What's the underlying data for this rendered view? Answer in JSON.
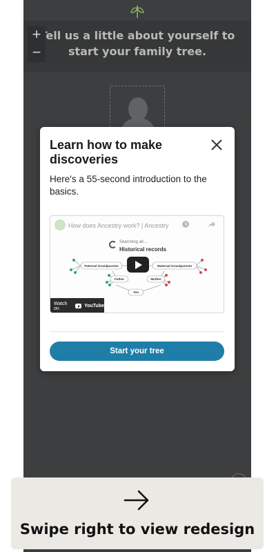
{
  "app": {
    "banner_text": "Tell us a little about yourself to start your family tree.",
    "zoom_in_label": "+",
    "zoom_out_label": "−"
  },
  "modal": {
    "title": "Learn how to make discoveries",
    "description": "Here's a 55-second introduction to the basics.",
    "video": {
      "title": "How does Ancestry work? | Ancestry",
      "searching_text": "Searching all...",
      "historical_text": "Historical records",
      "nodes": {
        "paternal": "Paternal Grandparents",
        "maternal": "Maternal Grandparents",
        "father": "Father",
        "mother": "Mother",
        "you": "You"
      },
      "watch_on_label": "Watch on",
      "youtube_label": "YouTube"
    },
    "start_button_label": "Start your tree"
  },
  "overlay": {
    "swipe_text": "Swipe right to view redesign"
  },
  "colors": {
    "accent": "#1f7ea8",
    "brand_green": "#8cb369",
    "background": "#3d3e3f"
  },
  "icons": [
    "leaf-logo-icon",
    "close-icon",
    "play-icon",
    "clock-icon",
    "share-icon",
    "youtube-icon",
    "arrow-right-icon",
    "help-icon"
  ]
}
